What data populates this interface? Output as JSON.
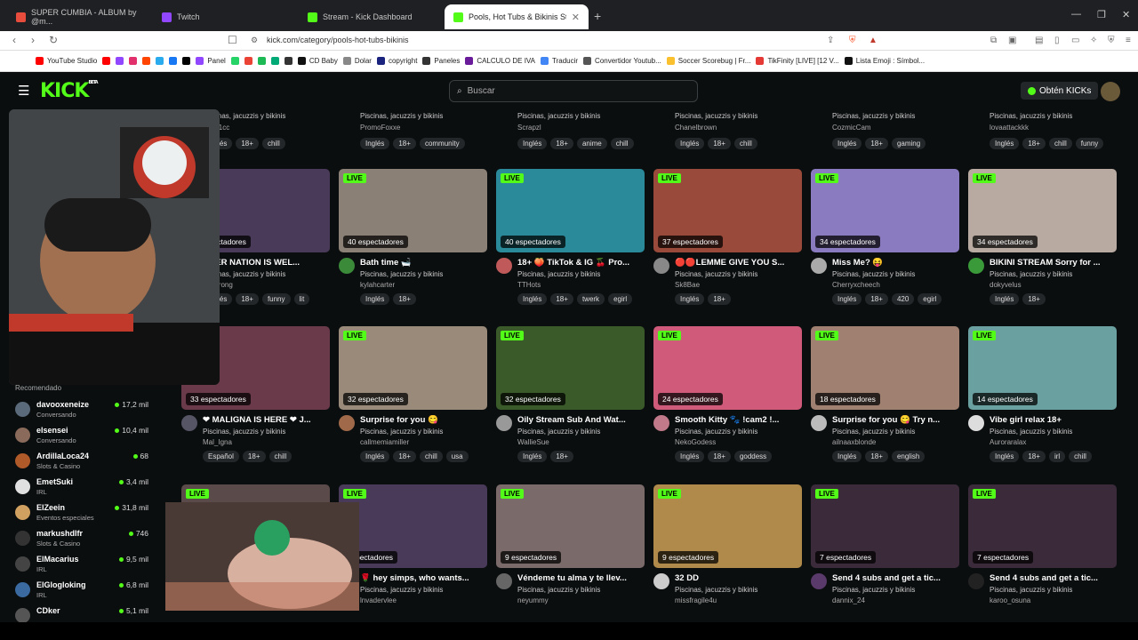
{
  "browser": {
    "tabs": [
      {
        "label": "SUPER CUMBIA - ALBUM by @m...",
        "color": "#e74c3c"
      },
      {
        "label": "Twitch",
        "color": "#9146ff"
      },
      {
        "label": "Stream - Kick Dashboard",
        "color": "#53fc18"
      },
      {
        "label": "Pools, Hot Tubs & Bikinis Stream...",
        "color": "#53fc18"
      }
    ],
    "url": "kick.com/category/pools-hot-tubs-bikinis",
    "bookmarks": [
      {
        "label": "YouTube Studio",
        "color": "#ff0000"
      },
      {
        "label": "",
        "color": "#ff0000"
      },
      {
        "label": "",
        "color": "#9146ff"
      },
      {
        "label": "",
        "color": "#e1306c"
      },
      {
        "label": "",
        "color": "#ff4500"
      },
      {
        "label": "",
        "color": "#2aabee"
      },
      {
        "label": "",
        "color": "#1877f2"
      },
      {
        "label": "",
        "color": "#000000"
      },
      {
        "label": "Panel",
        "color": "#9146ff"
      },
      {
        "label": "",
        "color": "#25d366"
      },
      {
        "label": "",
        "color": "#ea4335"
      },
      {
        "label": "",
        "color": "#1db954"
      },
      {
        "label": "",
        "color": "#0a7"
      },
      {
        "label": "",
        "color": "#333"
      },
      {
        "label": "CD Baby",
        "color": "#111"
      },
      {
        "label": "Dolar",
        "color": "#888"
      },
      {
        "label": "copyright",
        "color": "#1a237e"
      },
      {
        "label": "Paneles",
        "color": "#333"
      },
      {
        "label": "CALCULO DE IVA",
        "color": "#6a1b9a"
      },
      {
        "label": "Traducir",
        "color": "#4285f4"
      },
      {
        "label": "Convertidor Youtub...",
        "color": "#555"
      },
      {
        "label": "Soccer Scorebug | Fr...",
        "color": "#fbc02d"
      },
      {
        "label": "TikFinity [LIVE] [12 V...",
        "color": "#e53935"
      },
      {
        "label": "Lista Emoji : Símbol...",
        "color": "#111"
      }
    ]
  },
  "kick": {
    "search_placeholder": "Buscar",
    "get_kicks": "Obtén KICKs",
    "accent": "#53fc18"
  },
  "sidebar": {
    "title": "Recomendado",
    "items": [
      {
        "name": "davooxeneize",
        "category": "Conversando",
        "viewers": "17,2 mil",
        "color": "#5a6a7a"
      },
      {
        "name": "elsensei",
        "category": "Conversando",
        "viewers": "10,4 mil",
        "color": "#8a6a5a"
      },
      {
        "name": "ArdillaLoca24",
        "category": "Slots & Casino",
        "viewers": "68",
        "color": "#b05a2a"
      },
      {
        "name": "EmetSuki",
        "category": "IRL",
        "viewers": "3,4 mil",
        "color": "#e0e0e0"
      },
      {
        "name": "ElZeein",
        "category": "Eventos especiales",
        "viewers": "31,8 mil",
        "color": "#d0a060"
      },
      {
        "name": "markushdlfr",
        "category": "Slots & Casino",
        "viewers": "746",
        "color": "#333"
      },
      {
        "name": "ElMacarius",
        "category": "IRL",
        "viewers": "9,5 mil",
        "color": "#444"
      },
      {
        "name": "ElGlogloking",
        "category": "IRL",
        "viewers": "6,8 mil",
        "color": "#3a6aa0"
      },
      {
        "name": "CDker",
        "category": "",
        "viewers": "5,1 mil",
        "color": "#555"
      }
    ]
  },
  "toprow": [
    {
      "category": "Piscinas, jacuzzis y bikinis",
      "user": "mlTh1cc",
      "tags": [
        "Inglés",
        "18+",
        "chill"
      ]
    },
    {
      "category": "Piscinas, jacuzzis y bikinis",
      "user": "PromoFoxxe",
      "tags": [
        "Inglés",
        "18+",
        "community"
      ]
    },
    {
      "category": "Piscinas, jacuzzis y bikinis",
      "user": "Scrapzl",
      "tags": [
        "Inglés",
        "18+",
        "anime",
        "chill"
      ]
    },
    {
      "category": "Piscinas, jacuzzis y bikinis",
      "user": "Chanelbrown",
      "tags": [
        "Inglés",
        "18+",
        "chill"
      ]
    },
    {
      "category": "Piscinas, jacuzzis y bikinis",
      "user": "CozmicCam",
      "tags": [
        "Inglés",
        "18+",
        "gaming"
      ]
    },
    {
      "category": "Piscinas, jacuzzis y bikinis",
      "user": "lovaattackkk",
      "tags": [
        "Inglés",
        "18+",
        "chill",
        "funny"
      ]
    }
  ],
  "streams": [
    {
      "viewers": "40 espectadores",
      "title": "ONER NATION IS WEL...",
      "category": "Piscinas, jacuzzis y bikinis",
      "user": "berstrong",
      "tags": [
        "Inglés",
        "18+",
        "funny",
        "lit"
      ],
      "thumb": "#4a3a5a",
      "avatar": "#777"
    },
    {
      "viewers": "40 espectadores",
      "title": "Bath time 🛁",
      "category": "Piscinas, jacuzzis y bikinis",
      "user": "kylahcarter",
      "tags": [
        "Inglés",
        "18+"
      ],
      "thumb": "#8a8075",
      "avatar": "#3a8a3a"
    },
    {
      "viewers": "40 espectadores",
      "title": "18+ 🍑 TikTok & IG 🍒 Pro...",
      "category": "Piscinas, jacuzzis y bikinis",
      "user": "TTHots",
      "tags": [
        "Inglés",
        "18+",
        "twerk",
        "egirl"
      ],
      "thumb": "#2a8a9a",
      "avatar": "#c05a5a"
    },
    {
      "viewers": "37 espectadores",
      "title": "🔴🔴LEMME GIVE YOU S...",
      "category": "Piscinas, jacuzzis y bikinis",
      "user": "Sk8Bae",
      "tags": [
        "Inglés",
        "18+"
      ],
      "thumb": "#9a4a3a",
      "avatar": "#888"
    },
    {
      "viewers": "34 espectadores",
      "title": "Miss Me? 😝",
      "category": "Piscinas, jacuzzis y bikinis",
      "user": "Cherryxcheech",
      "tags": [
        "Inglés",
        "18+",
        "420",
        "egirl"
      ],
      "thumb": "#8a7ac0",
      "avatar": "#aaa"
    },
    {
      "viewers": "34 espectadores",
      "title": "BIKINI STREAM Sorry for ...",
      "category": "Piscinas, jacuzzis y bikinis",
      "user": "dokyvelus",
      "tags": [
        "Inglés",
        "18+"
      ],
      "thumb": "#b8aaa0",
      "avatar": "#3a9a3a"
    },
    {
      "viewers": "33 espectadores",
      "title": "❤ MALIGNA IS HERE ❤ J...",
      "category": "Piscinas, jacuzzis y bikinis",
      "user": "Mal_Igna",
      "tags": [
        "Español",
        "18+",
        "chill"
      ],
      "thumb": "#6a3a4a",
      "avatar": "#556"
    },
    {
      "viewers": "32 espectadores",
      "title": "Surprise for you 😋",
      "category": "Piscinas, jacuzzis y bikinis",
      "user": "callmemiamiller",
      "tags": [
        "Inglés",
        "18+",
        "chill",
        "usa"
      ],
      "thumb": "#9a8a7a",
      "avatar": "#a06a4a"
    },
    {
      "viewers": "32 espectadores",
      "title": "Oily Stream Sub And Wat...",
      "category": "Piscinas, jacuzzis y bikinis",
      "user": "WallieSue",
      "tags": [
        "Inglés",
        "18+"
      ],
      "thumb": "#3a5a2a",
      "avatar": "#999"
    },
    {
      "viewers": "24 espectadores",
      "title": "Smooth Kitty 🐾 !cam2 !...",
      "category": "Piscinas, jacuzzis y bikinis",
      "user": "NekoGodess",
      "tags": [
        "Inglés",
        "18+",
        "goddess"
      ],
      "thumb": "#d05a7a",
      "avatar": "#c07a8a"
    },
    {
      "viewers": "18 espectadores",
      "title": "Surprise for you 😋 Try n...",
      "category": "Piscinas, jacuzzis y bikinis",
      "user": "ailnaaxblonde",
      "tags": [
        "Inglés",
        "18+",
        "english"
      ],
      "thumb": "#a08070",
      "avatar": "#bbb"
    },
    {
      "viewers": "14 espectadores",
      "title": "Vibe girl relax 18+",
      "category": "Piscinas, jacuzzis y bikinis",
      "user": "Auroraralax",
      "tags": [
        "Inglés",
        "18+",
        "irl",
        "chill"
      ],
      "thumb": "#6aa0a0",
      "avatar": "#ddd"
    },
    {
      "viewers": "",
      "title": "",
      "category": "",
      "user": "",
      "tags": [],
      "thumb": "#5a4a4a",
      "avatar": "#555"
    },
    {
      "viewers": "espectadores",
      "title": "🌹 hey simps, who wants...",
      "category": "Piscinas, jacuzzis y bikinis",
      "user": "lnvadervlee",
      "tags": [],
      "thumb": "#4a3a5a",
      "avatar": "#a03a3a"
    },
    {
      "viewers": "9 espectadores",
      "title": "Véndeme tu alma y te llev...",
      "category": "Piscinas, jacuzzis y bikinis",
      "user": "neyummy",
      "tags": [],
      "thumb": "#7a6a6a",
      "avatar": "#666"
    },
    {
      "viewers": "9 espectadores",
      "title": "32 DD",
      "category": "Piscinas, jacuzzis y bikinis",
      "user": "missfragile4u",
      "tags": [],
      "thumb": "#b08a4a",
      "avatar": "#ccc"
    },
    {
      "viewers": "7 espectadores",
      "title": "Send 4 subs and get a tic...",
      "category": "Piscinas, jacuzzis y bikinis",
      "user": "dannix_24",
      "tags": [],
      "thumb": "#3a2a3a",
      "avatar": "#5a3a6a"
    },
    {
      "viewers": "7 espectadores",
      "title": "Send 4 subs and get a tic...",
      "category": "Piscinas, jacuzzis y bikinis",
      "user": "karoo_osuna",
      "tags": [],
      "thumb": "#3a2a3a",
      "avatar": "#222"
    }
  ]
}
